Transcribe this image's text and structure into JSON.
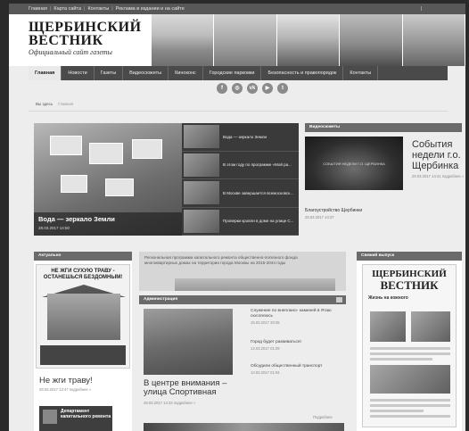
{
  "toplinks": [
    "Главная",
    "Карта сайта",
    "Контакты",
    "Реклама в издании и на сайте"
  ],
  "logo": {
    "line1": "ЩЕРБИНСКИЙ",
    "line2": "ВЕСТНИК",
    "tagline": "Официальный сайт газеты"
  },
  "nav": [
    "Главная",
    "Новости",
    "Газеты",
    "Видеосюжеты",
    "Киноконс",
    "Городские парковки",
    "Безопасность и правопорядок",
    "Контакты"
  ],
  "social": [
    "f",
    "◎",
    "vk",
    "▶",
    "t"
  ],
  "breadcrumb": {
    "home": "Вы здесь",
    "current": "Главная"
  },
  "hero": {
    "title": "Вода — зеркало Земли",
    "date": "28.03.2017 14:50",
    "items": [
      "Вода — зеркало Земли",
      "В этом году по программе «Мой ра...",
      "В Москве завершается всемосковск...",
      "Проверки кровли в доме на улице С..."
    ]
  },
  "video": {
    "header": "Видеосюжеты",
    "overlay": "СОБЫТИЯ НЕДЕЛИ Г.О. ЩЕРБИНКА",
    "title": "События недели г.о. Щербинка",
    "date": "29.03.2017 14:41 подробнее »",
    "caption": "Благоустройство Щербинки",
    "caption_date": "28.03.2017 14:37"
  },
  "actual": {
    "header": "Актуально",
    "poster_text": "НЕ ЖГИ СУХУЮ ТРАВУ - ОСТАНЕШЬСЯ БЕЗДОМНЫМ!",
    "title": "Не жги траву!",
    "date": "28.03.2017 13:47 подробнее »",
    "card_text": "Департамент капитального ремонта"
  },
  "banner": {
    "text": "Региональная программа капитального ремонта общественно-полезного фонда многоквартирных домах на территории города Москвы на 2015-2044 годы"
  },
  "admin": {
    "header": "Администрация",
    "title": "В центре внимания – улица Спортивная",
    "date": "28.03.2017 14:33 подробнее »",
    "items": [
      {
        "t": "Служение по внеплано- каменей в Ятаю сюсоялюсь",
        "d": "15.03.2017 20:35"
      },
      {
        "t": "Город будет развиваться!",
        "d": "13.03.2017 01:09"
      },
      {
        "t": "Обсудили общественный транспорт",
        "d": "13.03.2017 01:04"
      }
    ],
    "more": "Подробнее"
  },
  "issue": {
    "header": "Свежий выпуск",
    "mast1": "ЩЕРБИНСКИЙ",
    "mast2": "ВЕСТНИК",
    "headline": "Жизнь на кожного"
  }
}
